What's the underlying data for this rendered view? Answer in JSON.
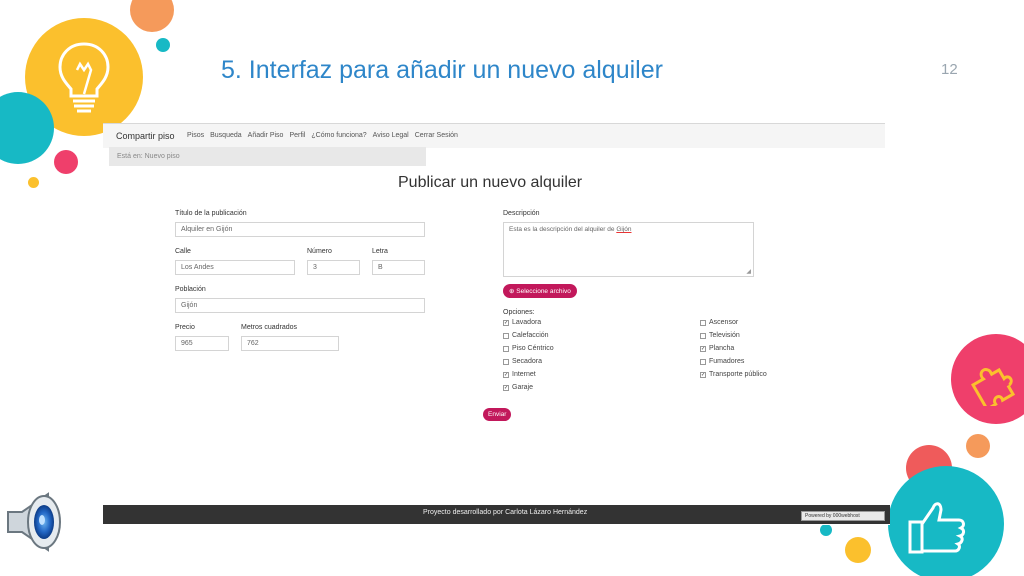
{
  "slide": {
    "title": "5. Interfaz para añadir un nuevo alquiler",
    "page_number": "12"
  },
  "navbar": {
    "brand": "Compartir piso",
    "items": [
      "Pisos",
      "Busqueda",
      "Añadir Piso",
      "Perfil",
      "¿Cómo funciona?",
      "Aviso Legal",
      "Cerrar Sesión"
    ]
  },
  "breadcrumb": "Está en: Nuevo piso",
  "form": {
    "heading": "Publicar un nuevo alquiler",
    "titulo_label": "Título de la publicación",
    "titulo_value": "Alquiler en Gijón",
    "calle_label": "Calle",
    "calle_value": "Los Andes",
    "numero_label": "Número",
    "numero_value": "3",
    "letra_label": "Letra",
    "letra_value": "B",
    "poblacion_label": "Población",
    "poblacion_value": "Gijón",
    "precio_label": "Precio",
    "precio_value": "965",
    "metros_label": "Metros cuadrados",
    "metros_value": "762",
    "descripcion_label": "Descripción",
    "descripcion_value_prefix": "Esta es la descripción del alquiler de ",
    "descripcion_value_word": "Gijón",
    "file_button": "⊕ Seleccione archivo",
    "opciones_label": "Opciones:",
    "submit": "Enviar"
  },
  "options": [
    {
      "label": "Lavadora",
      "checked": true
    },
    {
      "label": "Calefacción",
      "checked": false
    },
    {
      "label": "Piso Céntrico",
      "checked": false
    },
    {
      "label": "Secadora",
      "checked": false
    },
    {
      "label": "Internet",
      "checked": true
    },
    {
      "label": "Garaje",
      "checked": true
    },
    {
      "label": "Ascensor",
      "checked": false
    },
    {
      "label": "Televisión",
      "checked": false
    },
    {
      "label": "Plancha",
      "checked": true
    },
    {
      "label": "Fumadores",
      "checked": false
    },
    {
      "label": "Transporte público",
      "checked": true
    }
  ],
  "footer": {
    "text": "Proyecto desarrollado por Carlota Lázaro Hernández",
    "badge": "Powered by 000webhost"
  },
  "colors": {
    "accent": "#c2185b",
    "title_blue": "#2e86c9"
  }
}
